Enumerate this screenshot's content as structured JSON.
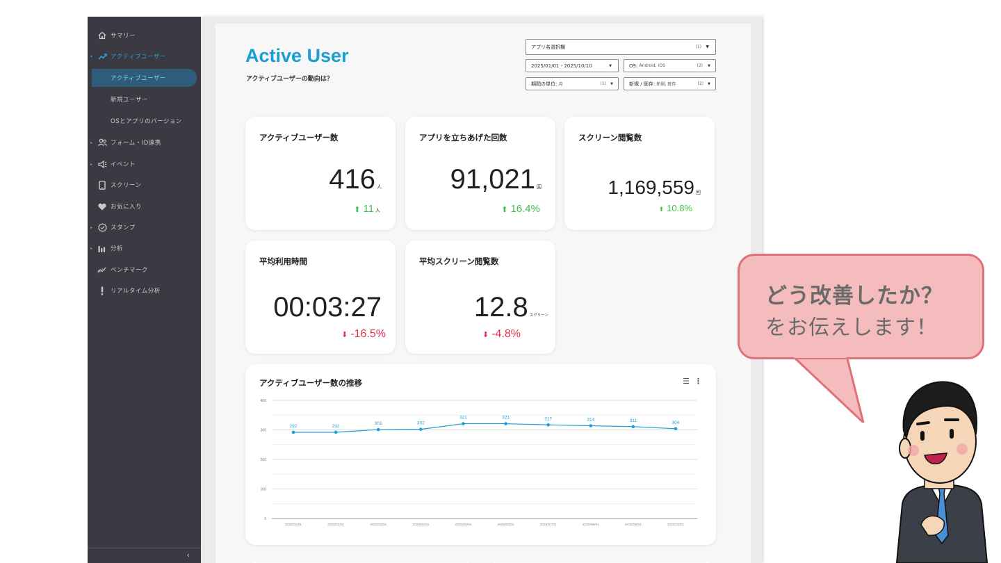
{
  "sidebar": {
    "items": [
      {
        "label": "サマリー",
        "icon": "home-icon"
      },
      {
        "label": "アクティブユーザー",
        "icon": "trending-up-icon"
      },
      {
        "label": "アクティブユーザー"
      },
      {
        "label": "新規ユーザー"
      },
      {
        "label": "OSとアプリのバージョン"
      },
      {
        "label": "フォーム・ID連携",
        "icon": "users-icon"
      },
      {
        "label": "イベント",
        "icon": "megaphone-icon"
      },
      {
        "label": "スクリーン",
        "icon": "phone-icon"
      },
      {
        "label": "お気に入り",
        "icon": "heart-icon"
      },
      {
        "label": "スタンプ",
        "icon": "stamp-icon"
      },
      {
        "label": "分析",
        "icon": "bar-chart-icon"
      },
      {
        "label": "ベンチマーク",
        "icon": "benchmark-icon"
      },
      {
        "label": "リアルタイム分析",
        "icon": "exclamation-icon"
      }
    ],
    "collapse_glyph": "‹"
  },
  "header": {
    "title": "Active User",
    "subtitle": "アクティブユーザーの動向は？"
  },
  "filters": {
    "app": {
      "label": "アプリ名選択欄",
      "count": "(1)"
    },
    "date_range": {
      "label": "2025/01/01 - 2025/10/10"
    },
    "os": {
      "label": "OS",
      "value": "Android, iOS",
      "count": "(2)"
    },
    "period_unit": {
      "label": "期間の単位",
      "value": "月",
      "count": "(1)"
    },
    "new_existing": {
      "label": "新規 / 既存",
      "value": "新規, 既存",
      "count": "(2)"
    }
  },
  "cards": [
    {
      "title": "アクティブユーザー数",
      "value": "416",
      "unit": "人",
      "delta": "11",
      "delta_unit": "人",
      "trend": "up"
    },
    {
      "title": "アプリを立ちあげた回数",
      "value": "91,021",
      "unit": "回",
      "delta": "16.4%",
      "trend": "up"
    },
    {
      "title": "スクリーン閲覧数",
      "value": "1,169,559",
      "unit": "回",
      "delta": "10.8%",
      "trend": "up"
    },
    {
      "title": "平均利用時間",
      "value": "00:03:27",
      "unit": "",
      "delta": "-16.5%",
      "trend": "down"
    },
    {
      "title": "平均スクリーン閲覧数",
      "value": "12.8",
      "unit": "スクリーン",
      "delta": "-4.8%",
      "trend": "down"
    }
  ],
  "colors": {
    "accent": "#1a9ed6",
    "sidebar_bg": "#3b3a42",
    "up": "#3fbf4a",
    "down": "#e0334e",
    "bubble_fill": "#f4bcbc",
    "bubble_border": "#e0707a"
  },
  "chart_data": {
    "type": "line",
    "title": "アクティブユーザー数の推移",
    "categories": [
      "2025/01/01",
      "2025/02/01",
      "2025/03/01",
      "2025/04/01",
      "2025/05/01",
      "2025/06/01",
      "2025/07/01",
      "2025/08/01",
      "2025/09/01",
      "2025/10/01"
    ],
    "values": [
      292,
      292,
      301,
      302,
      321,
      321,
      317,
      314,
      311,
      304
    ],
    "yticks": [
      0,
      100,
      200,
      300,
      400
    ],
    "ylim": [
      0,
      400
    ],
    "grid": true,
    "data_labels": true,
    "color": "#1a9ed6"
  },
  "chart_icons": {
    "filter": "filter-icon",
    "menu": "more-vert-icon"
  },
  "bubble": {
    "line1": "どう改善したか？",
    "line2": "をお伝えします！"
  }
}
